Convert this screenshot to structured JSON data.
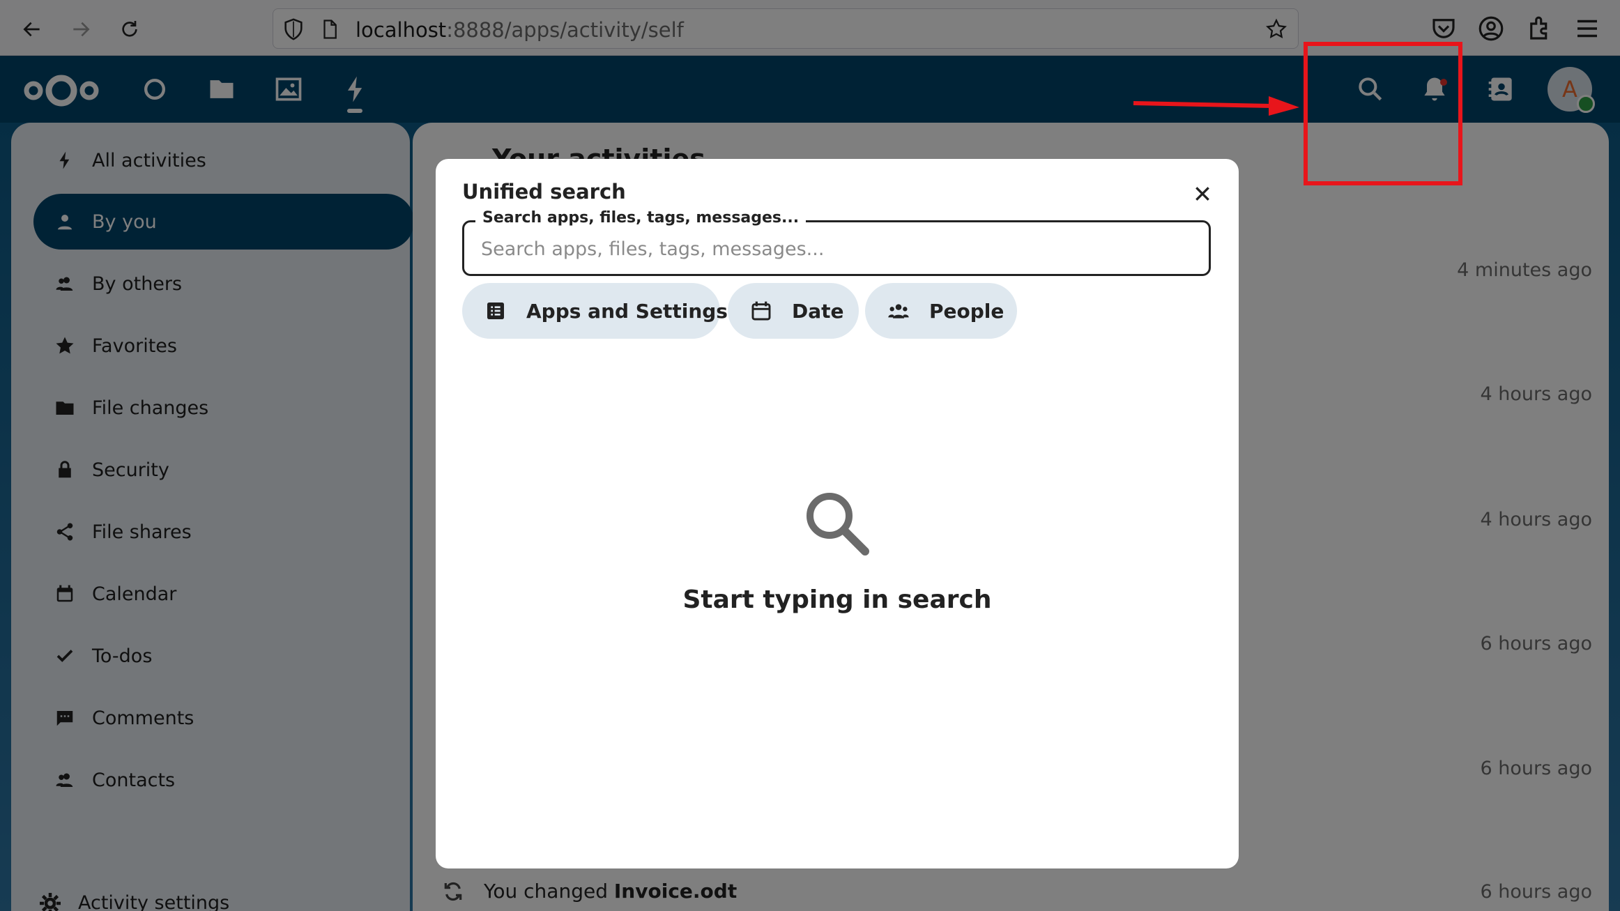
{
  "browser": {
    "url_host": "localhost",
    "url_path": ":8888/apps/activity/self"
  },
  "sidebar": {
    "items": [
      {
        "label": "All activities",
        "icon": "lightning-icon"
      },
      {
        "label": "By you",
        "icon": "person-icon",
        "active": true
      },
      {
        "label": "By others",
        "icon": "people-icon"
      },
      {
        "label": "Favorites",
        "icon": "star-icon"
      },
      {
        "label": "File changes",
        "icon": "folder-icon"
      },
      {
        "label": "Security",
        "icon": "lock-icon"
      },
      {
        "label": "File shares",
        "icon": "share-icon"
      },
      {
        "label": "Calendar",
        "icon": "calendar-icon"
      },
      {
        "label": "To-dos",
        "icon": "check-icon"
      },
      {
        "label": "Comments",
        "icon": "comment-icon"
      },
      {
        "label": "Contacts",
        "icon": "contacts-icon"
      }
    ],
    "settings_label": "Activity settings"
  },
  "main": {
    "title": "Your activities",
    "times": [
      "4 minutes ago",
      "4 hours ago",
      "4 hours ago",
      "6 hours ago",
      "6 hours ago",
      "6 hours ago"
    ],
    "last_activity_prefix": "You changed ",
    "last_activity_file": "Invoice.odt"
  },
  "header": {
    "avatar_letter": "A"
  },
  "modal": {
    "title": "Unified search",
    "field_label": "Search apps, files, tags, messages...",
    "placeholder": "Search apps, files, tags, messages...",
    "filters": [
      "Apps and Settings",
      "Date",
      "People"
    ],
    "empty_text": "Start typing in search"
  },
  "colors": {
    "brand": "#00456b",
    "annotation": "#e8151b"
  }
}
